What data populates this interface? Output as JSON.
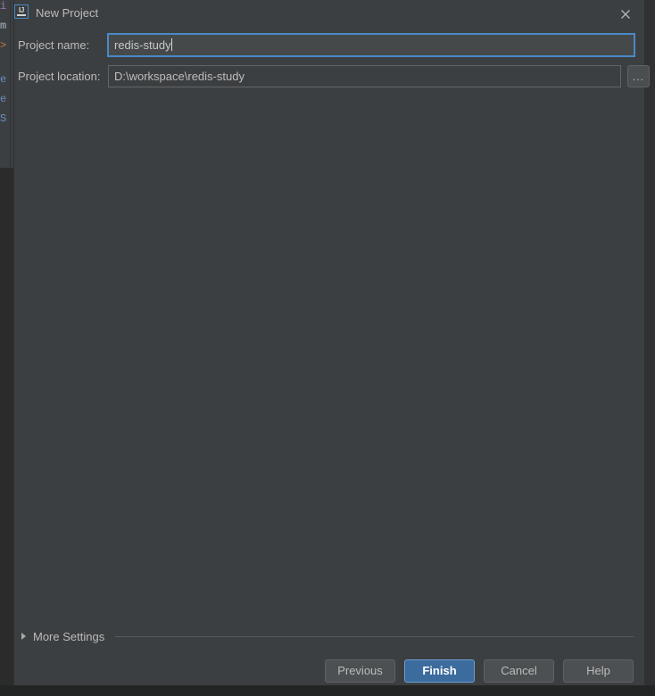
{
  "window": {
    "title": "New Project",
    "icon": "intellij-idea-icon",
    "close_icon": "close-icon"
  },
  "form": {
    "fields": [
      {
        "label": "Project name:",
        "value": "redis-study",
        "placeholder": "",
        "focused": true
      },
      {
        "label": "Project location:",
        "value": "D:\\workspace\\redis-study",
        "placeholder": "",
        "focused": false
      }
    ],
    "browse_button_label": "..."
  },
  "more_settings": {
    "label": "More Settings",
    "expanded": false,
    "disclosure_icon": "chevron-right-icon"
  },
  "buttons": [
    {
      "label": "Previous",
      "default": false
    },
    {
      "label": "Finish",
      "default": true
    },
    {
      "label": "Cancel",
      "default": false
    },
    {
      "label": "Help",
      "default": false
    }
  ],
  "background_editor": {
    "visible_fragments": [
      "i",
      "m",
      ">",
      "e",
      "e",
      "S"
    ]
  },
  "colors": {
    "dialog_background": "#3c3f41",
    "field_background": "#45494a",
    "focus_border": "#4a88c7",
    "default_button": "#3c6b9e",
    "text": "#bbbbbb",
    "editor_background": "#2b2b2b"
  }
}
